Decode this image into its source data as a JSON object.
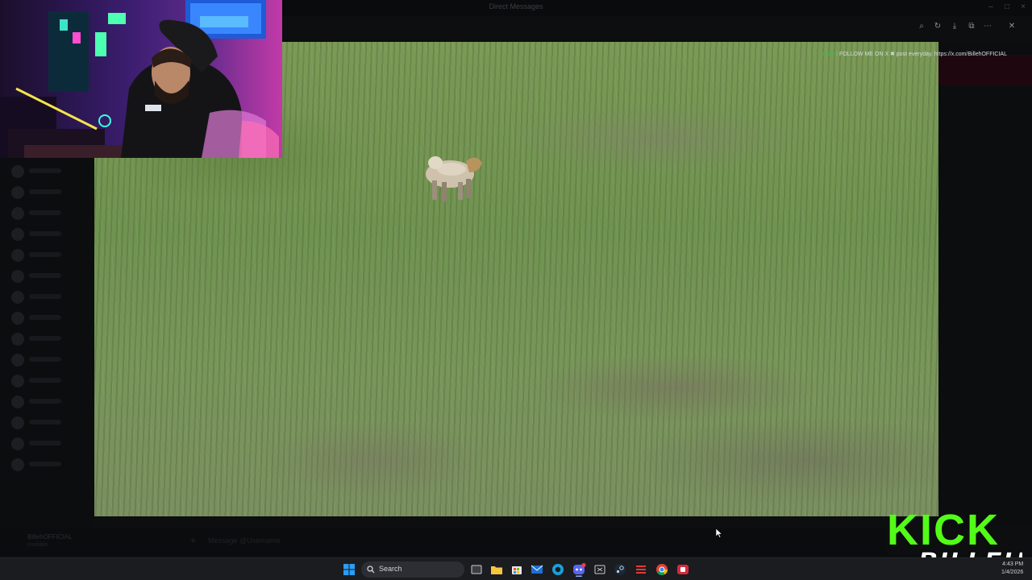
{
  "window": {
    "title": "Direct Messages",
    "controls": [
      "–",
      "□",
      "×"
    ]
  },
  "viewer_toolbar": {
    "icons": [
      "zoom-icon",
      "rotate-icon",
      "download-icon",
      "open-external-icon",
      "more-icon",
      "close-icon"
    ],
    "glyphs": [
      "⌕",
      "↻",
      "⤓",
      "⧉",
      "⋯",
      "✕"
    ]
  },
  "video": {
    "overlay": {
      "name": "Bodjix",
      "text": ": FOLLOW ME ON X ✖ post everyday. https://x.com/BillehOFFICIAL"
    }
  },
  "composer": {
    "username": "BillehOFFICIAL",
    "status": "Invisible",
    "placeholder": "Message @Username"
  },
  "branding": {
    "line1": "KICK",
    "line2": "BILLEH",
    "accent": "#53fc18"
  },
  "taskbar": {
    "search_label": "Search",
    "time": "4:43 PM",
    "date": "1/4/2026"
  }
}
